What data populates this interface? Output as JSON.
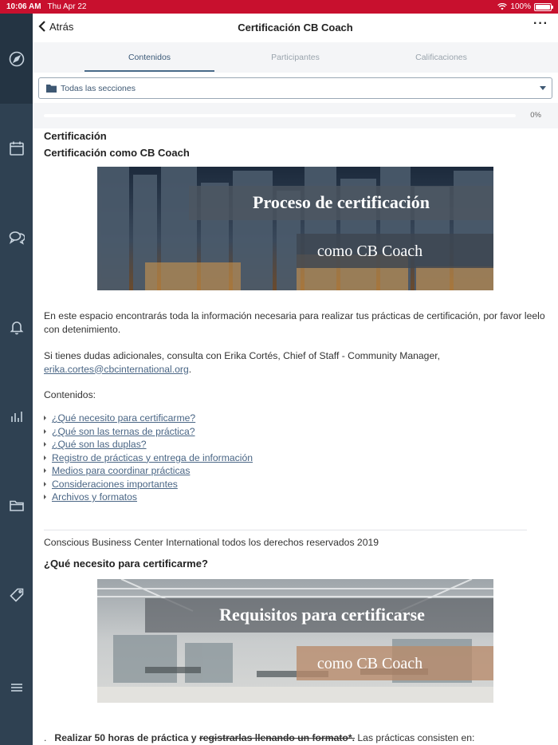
{
  "status_bar": {
    "time": "10:06 AM",
    "date": "Thu Apr 22",
    "battery": "100%"
  },
  "sidebar": {
    "items": [
      {
        "icon": "compass-icon",
        "active": true
      },
      {
        "icon": "calendar-icon"
      },
      {
        "icon": "chat-icon"
      },
      {
        "icon": "bell-icon"
      },
      {
        "icon": "bar-chart-icon"
      },
      {
        "icon": "folder-icon"
      },
      {
        "icon": "tag-icon"
      },
      {
        "icon": "menu-icon"
      }
    ]
  },
  "header": {
    "back_label": "Atrás",
    "title": "Certificación CB Coach",
    "more_label": "···"
  },
  "tabs": [
    {
      "label": "Contenidos",
      "active": true
    },
    {
      "label": "Participantes"
    },
    {
      "label": "Calificaciones"
    }
  ],
  "section_select": {
    "value": "Todas las secciones"
  },
  "progress": {
    "value": 0,
    "label": "0%"
  },
  "content": {
    "section_title": "Certificación",
    "subtitle": "Certificación como CB Coach",
    "banner1": {
      "line1": "Proceso de certificación",
      "line2": "como CB Coach"
    },
    "intro": "En este espacio encontrarás toda la información necesaria para realizar tus prácticas de certificación, por favor leelo con detenimiento.",
    "contact_text": "Si tienes dudas adicionales, consulta con Erika Cortés, Chief of Staff - Community Manager,",
    "contact_email": "erika.cortes@cbcinternational.org",
    "contact_suffix": ".",
    "contents_label": "Contenidos:",
    "toc": [
      "¿Qué necesito para certificarme?",
      "¿Qué son las ternas de práctica?",
      "¿Qué son las duplas?",
      "Registro de prácticas y entrega de información",
      "Medios para coordinar prácticas",
      "Consideraciones importantes",
      "Archivos y formatos"
    ],
    "copyright": "Conscious Business Center International todos los derechos reservados 2019",
    "question_heading": "¿Qué necesito para certificarme?",
    "banner2": {
      "line1": "Requisitos para certificarse",
      "line2": "como CB Coach"
    },
    "requirement_bold": "Realizar 50 horas de práctica y",
    "requirement_struck": "registrarlas llenando un formato*.",
    "requirement_rest": " Las prácticas consisten en:"
  }
}
